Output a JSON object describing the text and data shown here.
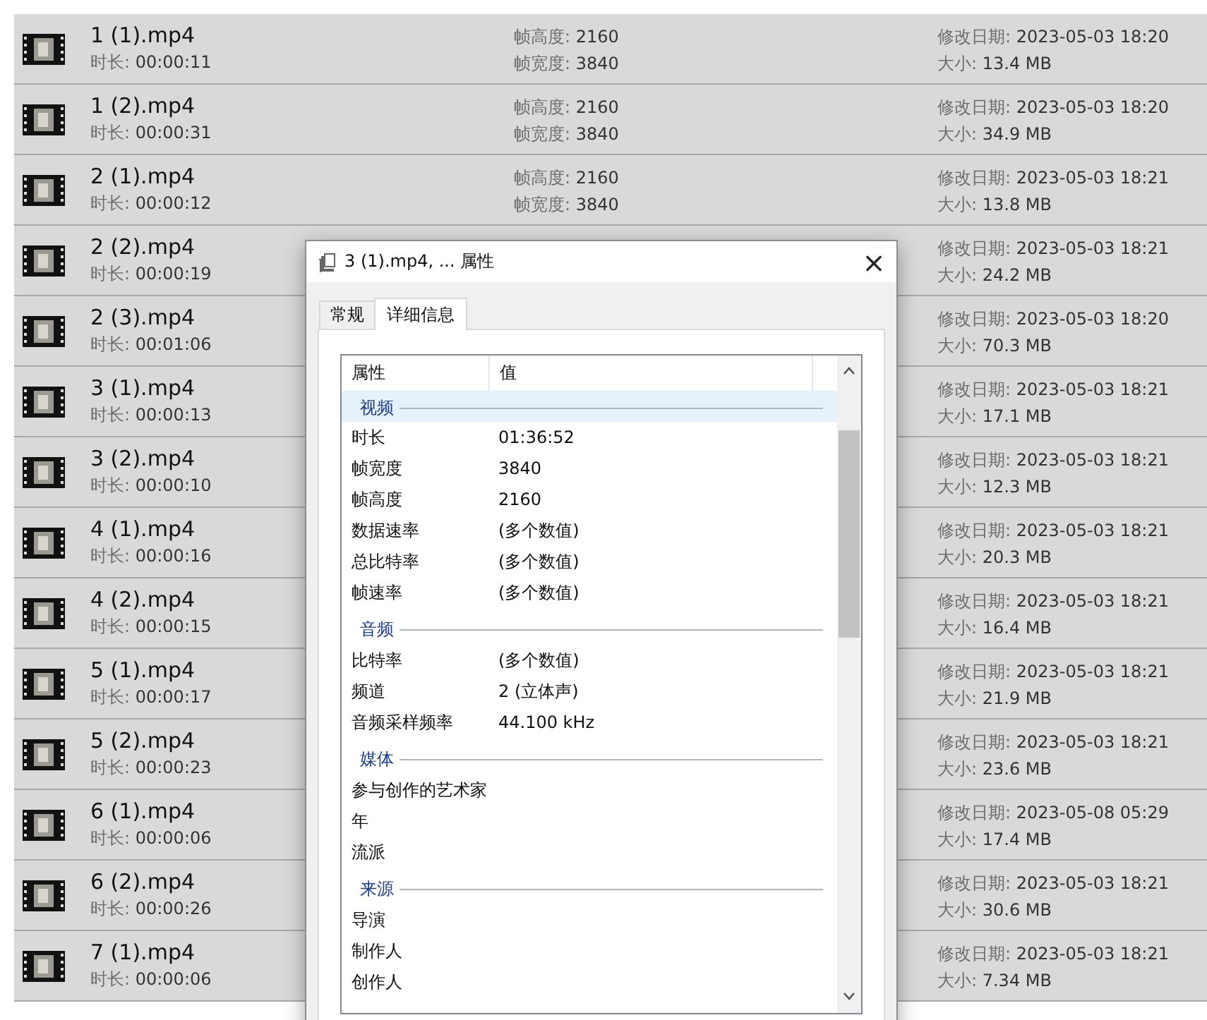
{
  "files": [
    {
      "name": "1 (1).mp4",
      "duration": {
        "label": "时长:",
        "value": "00:00:11"
      },
      "frame_height": {
        "label": "帧高度:",
        "value": "2160"
      },
      "frame_width": {
        "label": "帧宽度:",
        "value": "3840"
      },
      "modified": {
        "label": "修改日期:",
        "value": "2023-05-03 18:20"
      },
      "size": {
        "label": "大小:",
        "value": "13.4 MB"
      }
    },
    {
      "name": "1 (2).mp4",
      "duration": {
        "label": "时长:",
        "value": "00:00:31"
      },
      "frame_height": {
        "label": "帧高度:",
        "value": "2160"
      },
      "frame_width": {
        "label": "帧宽度:",
        "value": "3840"
      },
      "modified": {
        "label": "修改日期:",
        "value": "2023-05-03 18:20"
      },
      "size": {
        "label": "大小:",
        "value": "34.9 MB"
      }
    },
    {
      "name": "2 (1).mp4",
      "duration": {
        "label": "时长:",
        "value": "00:00:12"
      },
      "frame_height": {
        "label": "帧高度:",
        "value": "2160"
      },
      "frame_width": {
        "label": "帧宽度:",
        "value": "3840"
      },
      "modified": {
        "label": "修改日期:",
        "value": "2023-05-03 18:21"
      },
      "size": {
        "label": "大小:",
        "value": "13.8 MB"
      }
    },
    {
      "name": "2 (2).mp4",
      "duration": {
        "label": "时长:",
        "value": "00:00:19"
      },
      "modified": {
        "label": "修改日期:",
        "value": "2023-05-03 18:21"
      },
      "size": {
        "label": "大小:",
        "value": "24.2 MB"
      }
    },
    {
      "name": "2 (3).mp4",
      "duration": {
        "label": "时长:",
        "value": "00:01:06"
      },
      "modified": {
        "label": "修改日期:",
        "value": "2023-05-03 18:20"
      },
      "size": {
        "label": "大小:",
        "value": "70.3 MB"
      }
    },
    {
      "name": "3 (1).mp4",
      "duration": {
        "label": "时长:",
        "value": "00:00:13"
      },
      "modified": {
        "label": "修改日期:",
        "value": "2023-05-03 18:21"
      },
      "size": {
        "label": "大小:",
        "value": "17.1 MB"
      }
    },
    {
      "name": "3 (2).mp4",
      "duration": {
        "label": "时长:",
        "value": "00:00:10"
      },
      "modified": {
        "label": "修改日期:",
        "value": "2023-05-03 18:21"
      },
      "size": {
        "label": "大小:",
        "value": "12.3 MB"
      }
    },
    {
      "name": "4 (1).mp4",
      "duration": {
        "label": "时长:",
        "value": "00:00:16"
      },
      "modified": {
        "label": "修改日期:",
        "value": "2023-05-03 18:21"
      },
      "size": {
        "label": "大小:",
        "value": "20.3 MB"
      }
    },
    {
      "name": "4 (2).mp4",
      "duration": {
        "label": "时长:",
        "value": "00:00:15"
      },
      "modified": {
        "label": "修改日期:",
        "value": "2023-05-03 18:21"
      },
      "size": {
        "label": "大小:",
        "value": "16.4 MB"
      }
    },
    {
      "name": "5 (1).mp4",
      "duration": {
        "label": "时长:",
        "value": "00:00:17"
      },
      "modified": {
        "label": "修改日期:",
        "value": "2023-05-03 18:21"
      },
      "size": {
        "label": "大小:",
        "value": "21.9 MB"
      }
    },
    {
      "name": "5 (2).mp4",
      "duration": {
        "label": "时长:",
        "value": "00:00:23"
      },
      "modified": {
        "label": "修改日期:",
        "value": "2023-05-03 18:21"
      },
      "size": {
        "label": "大小:",
        "value": "23.6 MB"
      }
    },
    {
      "name": "6 (1).mp4",
      "duration": {
        "label": "时长:",
        "value": "00:00:06"
      },
      "modified": {
        "label": "修改日期:",
        "value": "2023-05-08 05:29"
      },
      "size": {
        "label": "大小:",
        "value": "17.4 MB"
      }
    },
    {
      "name": "6 (2).mp4",
      "duration": {
        "label": "时长:",
        "value": "00:00:26"
      },
      "modified": {
        "label": "修改日期:",
        "value": "2023-05-03 18:21"
      },
      "size": {
        "label": "大小:",
        "value": "30.6 MB"
      }
    },
    {
      "name": "7 (1).mp4",
      "duration": {
        "label": "时长:",
        "value": "00:00:06"
      },
      "modified": {
        "label": "修改日期:",
        "value": "2023-05-03 18:21"
      },
      "size": {
        "label": "大小:",
        "value": "7.34 MB"
      }
    }
  ],
  "dialog": {
    "title": "3 (1).mp4, ... 属性",
    "close": "×",
    "tabs": [
      {
        "label": "常规",
        "selected": false
      },
      {
        "label": "详细信息",
        "selected": true
      }
    ],
    "columns": [
      "属性",
      "值"
    ],
    "groups": [
      {
        "title": "视频",
        "selected": true,
        "items": [
          {
            "name": "时长",
            "value": "01:36:52"
          },
          {
            "name": "帧宽度",
            "value": "3840"
          },
          {
            "name": "帧高度",
            "value": "2160"
          },
          {
            "name": "数据速率",
            "value": "(多个数值)"
          },
          {
            "name": "总比特率",
            "value": "(多个数值)"
          },
          {
            "name": "帧速率",
            "value": "(多个数值)"
          }
        ]
      },
      {
        "title": "音频",
        "selected": false,
        "items": [
          {
            "name": "比特率",
            "value": "(多个数值)"
          },
          {
            "name": "频道",
            "value": "2 (立体声)"
          },
          {
            "name": "音频采样频率",
            "value": "44.100 kHz"
          }
        ]
      },
      {
        "title": "媒体",
        "selected": false,
        "items": [
          {
            "name": "参与创作的艺术家"
          },
          {
            "name": "年"
          },
          {
            "name": "流派"
          }
        ]
      },
      {
        "title": "来源",
        "selected": false,
        "items": [
          {
            "name": "导演"
          },
          {
            "name": "制作人"
          },
          {
            "name": "创作人"
          }
        ]
      }
    ]
  }
}
